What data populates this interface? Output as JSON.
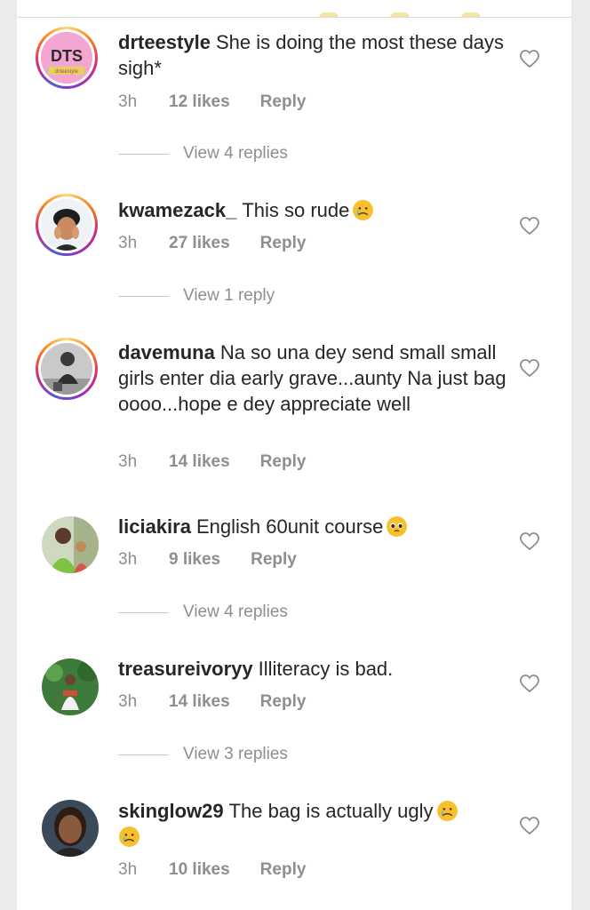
{
  "colors": {
    "text": "#262626",
    "muted": "#8e8e8e",
    "story_ring": [
      "#feda75",
      "#fa7e1e",
      "#d62976",
      "#962fbf",
      "#4f5bd5"
    ]
  },
  "comments": [
    {
      "username": "drteestyle",
      "text": "She is doing the most these days sigh*",
      "time": "3h",
      "likes": "12 likes",
      "reply": "Reply",
      "view_replies": "View 4 replies",
      "avatar_text": "DTS",
      "avatar_subtext": "drteestyle",
      "emoji": ""
    },
    {
      "username": "kwamezack_",
      "text": "This so rude",
      "time": "3h",
      "likes": "27 likes",
      "reply": "Reply",
      "view_replies": "View 1 reply",
      "emoji": "sad-tear-emoji"
    },
    {
      "username": "davemuna",
      "text": "Na so una dey send small small girls enter dia early grave...aunty Na just bag oooo...hope e dey appreciate well",
      "time": "3h",
      "likes": "14 likes",
      "reply": "Reply",
      "view_replies": "",
      "emoji": ""
    },
    {
      "username": "liciakira",
      "text": "English 60unit course",
      "time": "3h",
      "likes": "9 likes",
      "reply": "Reply",
      "view_replies": "View 4 replies",
      "emoji": "pleading-face-emoji"
    },
    {
      "username": "treasureivoryy",
      "text": "Illiteracy is bad.",
      "time": "3h",
      "likes": "14 likes",
      "reply": "Reply",
      "view_replies": "View 3 replies",
      "emoji": ""
    },
    {
      "username": "skinglow29",
      "text": "The bag is actually ugly",
      "time": "3h",
      "likes": "10 likes",
      "reply": "Reply",
      "view_replies": "",
      "emoji": "sad-tear-emoji"
    }
  ]
}
